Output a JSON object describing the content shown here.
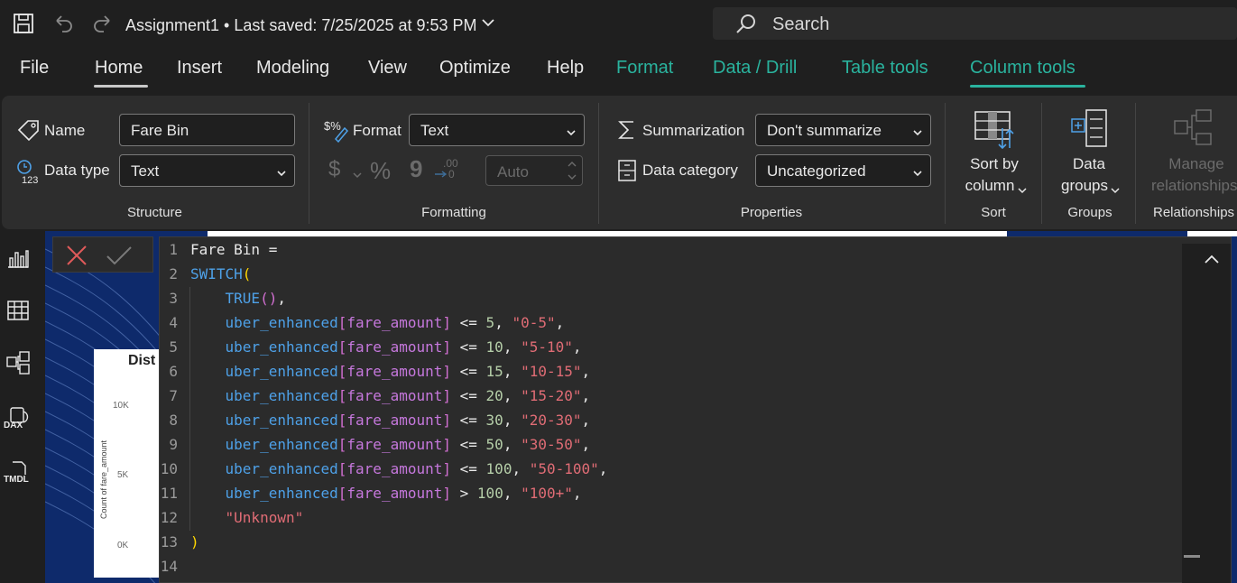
{
  "titlebar": {
    "doc_title": "Assignment1 • Last saved: 7/25/2025 at 9:53 PM",
    "search_placeholder": "Search"
  },
  "tabs": [
    {
      "label": "File"
    },
    {
      "label": "Home"
    },
    {
      "label": "Insert"
    },
    {
      "label": "Modeling"
    },
    {
      "label": "View"
    },
    {
      "label": "Optimize"
    },
    {
      "label": "Help"
    },
    {
      "label": "Format"
    },
    {
      "label": "Data / Drill"
    },
    {
      "label": "Table tools"
    },
    {
      "label": "Column tools"
    }
  ],
  "ribbon": {
    "structure": {
      "name_label": "Name",
      "name_value": "Fare Bin",
      "datatype_label": "Data type",
      "datatype_value": "Text",
      "group_label": "Structure"
    },
    "formatting": {
      "format_label": "Format",
      "format_value": "Text",
      "currency_symbol": "$",
      "percent_symbol": "%",
      "comma_symbol": "9",
      "decimals_top": ".00",
      "decimals_bottom": "0",
      "auto_value": "Auto",
      "group_label": "Formatting"
    },
    "properties": {
      "summarization_label": "Summarization",
      "summarization_value": "Don't summarize",
      "datacategory_label": "Data category",
      "datacategory_value": "Uncategorized",
      "group_label": "Properties"
    },
    "sort": {
      "button_line1": "Sort by",
      "button_line2": "column",
      "group_label": "Sort"
    },
    "groups": {
      "button_line1": "Data",
      "button_line2": "groups",
      "group_label": "Groups"
    },
    "relationships": {
      "button_line1": "Manage",
      "button_line2": "relationships",
      "group_label": "Relationships"
    }
  },
  "chart": {
    "title": "Dist",
    "yticks": [
      "10K",
      "5K",
      "0K"
    ],
    "ylabel": "Count of fare_amount"
  },
  "editor": {
    "line_numbers": [
      "1",
      "2",
      "3",
      "4",
      "5",
      "6",
      "7",
      "8",
      "9",
      "10",
      "11",
      "12",
      "13",
      "14"
    ],
    "lines": [
      [
        {
          "t": "Fare Bin =",
          "c": ""
        }
      ],
      [
        {
          "t": "SWITCH",
          "c": "k"
        },
        {
          "t": "(",
          "c": "p1"
        }
      ],
      [
        {
          "t": "    ",
          "c": ""
        },
        {
          "t": "TRUE",
          "c": "k"
        },
        {
          "t": "()",
          "c": "p2"
        },
        {
          "t": ",",
          "c": ""
        }
      ],
      [
        {
          "t": "    ",
          "c": ""
        },
        {
          "t": "uber_enhanced",
          "c": "t"
        },
        {
          "t": "[",
          "c": "p2"
        },
        {
          "t": "fare_amount",
          "c": "c"
        },
        {
          "t": "]",
          "c": "p2"
        },
        {
          "t": " <= ",
          "c": ""
        },
        {
          "t": "5",
          "c": "n"
        },
        {
          "t": ", ",
          "c": ""
        },
        {
          "t": "\"0-5\"",
          "c": "s"
        },
        {
          "t": ",",
          "c": ""
        }
      ],
      [
        {
          "t": "    ",
          "c": ""
        },
        {
          "t": "uber_enhanced",
          "c": "t"
        },
        {
          "t": "[",
          "c": "p2"
        },
        {
          "t": "fare_amount",
          "c": "c"
        },
        {
          "t": "]",
          "c": "p2"
        },
        {
          "t": " <= ",
          "c": ""
        },
        {
          "t": "10",
          "c": "n"
        },
        {
          "t": ", ",
          "c": ""
        },
        {
          "t": "\"5-10\"",
          "c": "s"
        },
        {
          "t": ",",
          "c": ""
        }
      ],
      [
        {
          "t": "    ",
          "c": ""
        },
        {
          "t": "uber_enhanced",
          "c": "t"
        },
        {
          "t": "[",
          "c": "p2"
        },
        {
          "t": "fare_amount",
          "c": "c"
        },
        {
          "t": "]",
          "c": "p2"
        },
        {
          "t": " <= ",
          "c": ""
        },
        {
          "t": "15",
          "c": "n"
        },
        {
          "t": ", ",
          "c": ""
        },
        {
          "t": "\"10-15\"",
          "c": "s"
        },
        {
          "t": ",",
          "c": ""
        }
      ],
      [
        {
          "t": "    ",
          "c": ""
        },
        {
          "t": "uber_enhanced",
          "c": "t"
        },
        {
          "t": "[",
          "c": "p2"
        },
        {
          "t": "fare_amount",
          "c": "c"
        },
        {
          "t": "]",
          "c": "p2"
        },
        {
          "t": " <= ",
          "c": ""
        },
        {
          "t": "20",
          "c": "n"
        },
        {
          "t": ", ",
          "c": ""
        },
        {
          "t": "\"15-20\"",
          "c": "s"
        },
        {
          "t": ",",
          "c": ""
        }
      ],
      [
        {
          "t": "    ",
          "c": ""
        },
        {
          "t": "uber_enhanced",
          "c": "t"
        },
        {
          "t": "[",
          "c": "p2"
        },
        {
          "t": "fare_amount",
          "c": "c"
        },
        {
          "t": "]",
          "c": "p2"
        },
        {
          "t": " <= ",
          "c": ""
        },
        {
          "t": "30",
          "c": "n"
        },
        {
          "t": ", ",
          "c": ""
        },
        {
          "t": "\"20-30\"",
          "c": "s"
        },
        {
          "t": ",",
          "c": ""
        }
      ],
      [
        {
          "t": "    ",
          "c": ""
        },
        {
          "t": "uber_enhanced",
          "c": "t"
        },
        {
          "t": "[",
          "c": "p2"
        },
        {
          "t": "fare_amount",
          "c": "c"
        },
        {
          "t": "]",
          "c": "p2"
        },
        {
          "t": " <= ",
          "c": ""
        },
        {
          "t": "50",
          "c": "n"
        },
        {
          "t": ", ",
          "c": ""
        },
        {
          "t": "\"30-50\"",
          "c": "s"
        },
        {
          "t": ",",
          "c": ""
        }
      ],
      [
        {
          "t": "    ",
          "c": ""
        },
        {
          "t": "uber_enhanced",
          "c": "t"
        },
        {
          "t": "[",
          "c": "p2"
        },
        {
          "t": "fare_amount",
          "c": "c"
        },
        {
          "t": "]",
          "c": "p2"
        },
        {
          "t": " <= ",
          "c": ""
        },
        {
          "t": "100",
          "c": "n"
        },
        {
          "t": ", ",
          "c": ""
        },
        {
          "t": "\"50-100\"",
          "c": "s"
        },
        {
          "t": ",",
          "c": ""
        }
      ],
      [
        {
          "t": "    ",
          "c": ""
        },
        {
          "t": "uber_enhanced",
          "c": "t"
        },
        {
          "t": "[",
          "c": "p2"
        },
        {
          "t": "fare_amount",
          "c": "c"
        },
        {
          "t": "]",
          "c": "p2"
        },
        {
          "t": " > ",
          "c": ""
        },
        {
          "t": "100",
          "c": "n"
        },
        {
          "t": ", ",
          "c": ""
        },
        {
          "t": "\"100+\"",
          "c": "s"
        },
        {
          "t": ",",
          "c": ""
        }
      ],
      [
        {
          "t": "    ",
          "c": ""
        },
        {
          "t": "\"Unknown\"",
          "c": "s"
        }
      ],
      [
        {
          "t": ")",
          "c": "p1"
        }
      ],
      [
        {
          "t": "",
          "c": ""
        }
      ]
    ]
  },
  "rail": {
    "icons": [
      "report-view-icon",
      "table-view-icon",
      "model-view-icon",
      "dax-query-view-icon",
      "tmdl-view-icon"
    ],
    "dax_label": "DAX",
    "tmdl_label": "TMDL"
  },
  "colors": {
    "accent_teal": "#2ab39e",
    "ribbon_bg": "#2d2d2d",
    "canvas_bg": "#0e2a6b"
  }
}
